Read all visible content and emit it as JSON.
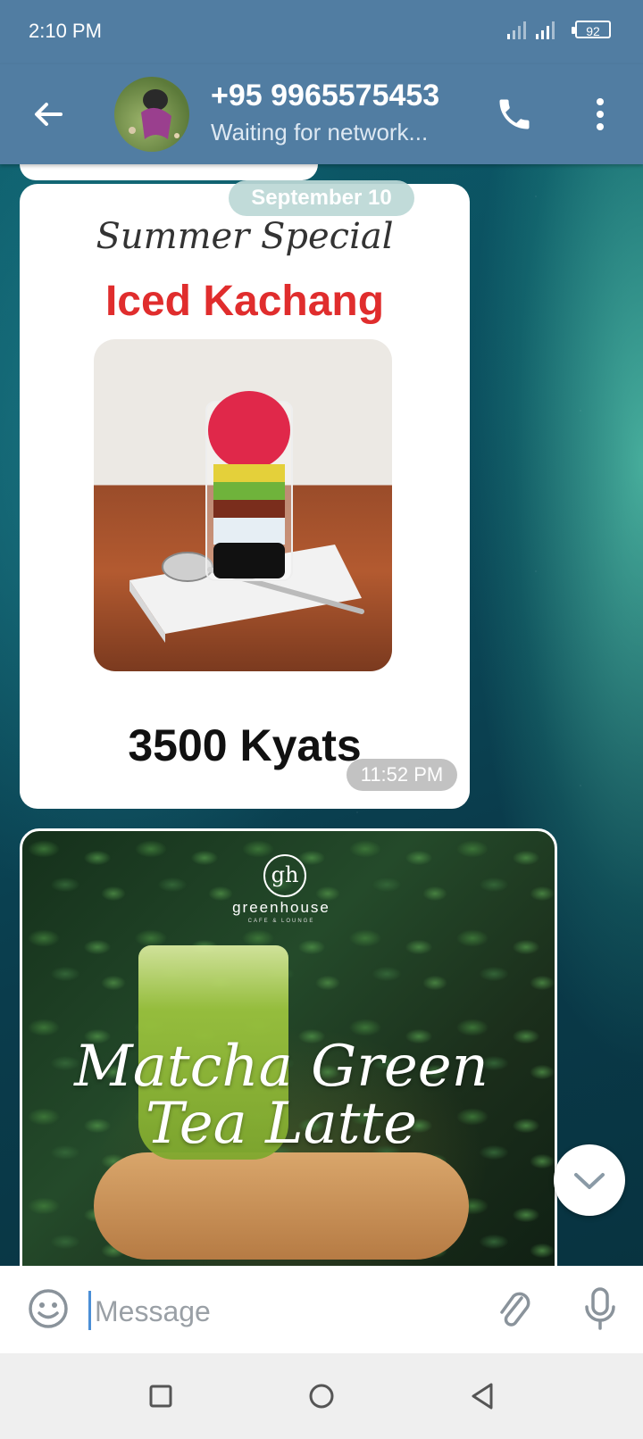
{
  "status_bar": {
    "time": "2:10 PM",
    "battery": "92"
  },
  "header": {
    "contact_name": "+95 9965575453",
    "status": "Waiting for network..."
  },
  "chat": {
    "date_separator": "September 10",
    "message1": {
      "subtitle": "Summer Special",
      "title": "Iced Kachang",
      "price": "3500 Kyats",
      "time": "11:52 PM"
    },
    "message2": {
      "brand_logo": "gh",
      "brand_name": "greenhouse",
      "brand_sub": "CAFE & LOUNGE",
      "title_line1": "Matcha Green",
      "title_line2": "Tea Latte"
    }
  },
  "composer": {
    "placeholder": "Message"
  },
  "colors": {
    "header": "#517da2",
    "accent": "#4b8fd6",
    "promo_red": "#e02d2d"
  }
}
